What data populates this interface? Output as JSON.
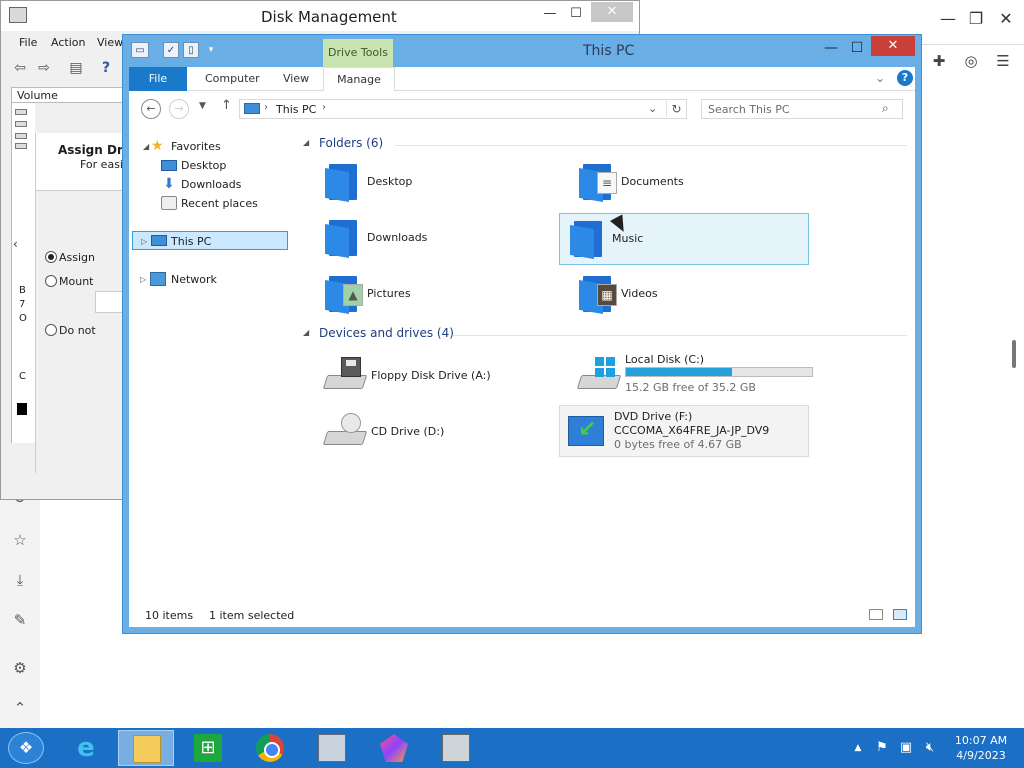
{
  "disk_management": {
    "title": "Disk Management",
    "menu": [
      "File",
      "Action",
      "View"
    ],
    "column_volume": "Volume",
    "dialog_title": "Assign Drive",
    "dialog_subtitle": "For easier",
    "radio_assign": "Assign",
    "radio_mount": "Mount",
    "radio_donot": "Do not",
    "strip_letters": [
      "B",
      "7",
      "O",
      "C"
    ]
  },
  "explorer": {
    "title": "This PC",
    "contextual_tab": "Drive Tools",
    "tabs": [
      "File",
      "Computer",
      "View",
      "Manage"
    ],
    "address": "This PC",
    "search_placeholder": "Search This PC",
    "nav": {
      "favorites": "Favorites",
      "desktop": "Desktop",
      "downloads": "Downloads",
      "recent": "Recent places",
      "this_pc": "This PC",
      "network": "Network"
    },
    "folders_header": "Folders (6)",
    "folders": [
      {
        "name": "Desktop",
        "icon": "desktop-folder-icon"
      },
      {
        "name": "Documents",
        "icon": "documents-folder-icon"
      },
      {
        "name": "Downloads",
        "icon": "downloads-folder-icon"
      },
      {
        "name": "Music",
        "icon": "music-folder-icon"
      },
      {
        "name": "Pictures",
        "icon": "pictures-folder-icon"
      },
      {
        "name": "Videos",
        "icon": "videos-folder-icon"
      }
    ],
    "devices_header": "Devices and drives (4)",
    "drives": {
      "floppy": {
        "name": "Floppy Disk Drive (A:)"
      },
      "local": {
        "name": "Local Disk (C:)",
        "free": "15.2 GB free of 35.2 GB",
        "used_fraction": 0.57
      },
      "cd": {
        "name": "CD Drive (D:)"
      },
      "dvd": {
        "name": "DVD Drive (F:)",
        "label": "CCCOMA_X64FRE_JA-JP_DV9",
        "free": "0 bytes free of 4.67 GB"
      }
    },
    "status_items": "10 items",
    "status_selected": "1 item selected"
  },
  "taskbar": {
    "time": "10:07 AM",
    "date": "4/9/2023"
  },
  "colors": {
    "accent": "#1979ca",
    "window_frame": "#6aaee6",
    "close": "#c9403a",
    "taskbar": "#1b6fc4",
    "drive_tools": "#c9e3b1"
  }
}
